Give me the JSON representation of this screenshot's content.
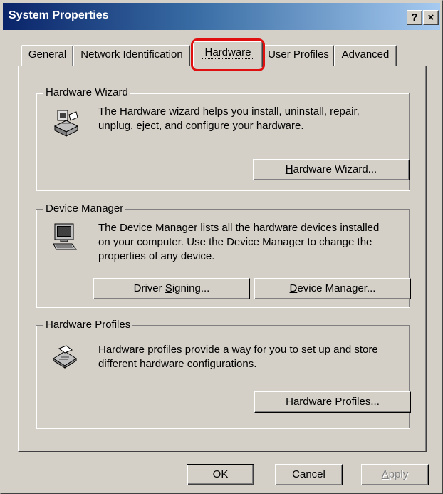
{
  "window": {
    "title": "System Properties",
    "help_button": "?",
    "close_button": "×"
  },
  "tabs": [
    {
      "label": "General"
    },
    {
      "label": "Network Identification"
    },
    {
      "label": "Hardware"
    },
    {
      "label": "User Profiles"
    },
    {
      "label": "Advanced"
    }
  ],
  "active_tab": "Hardware",
  "highlight_color": "#e01010",
  "groups": {
    "hardware_wizard": {
      "title": "Hardware Wizard",
      "text_line1": "The Hardware wizard helps you install, uninstall, repair,",
      "text_line2": "unplug, eject, and configure your hardware.",
      "button": {
        "pre": "",
        "accel": "H",
        "post": "ardware Wizard..."
      },
      "icon": "hardware-wizard-icon"
    },
    "device_manager": {
      "title": "Device Manager",
      "text_line1": "The Device Manager lists all the hardware devices installed",
      "text_line2": "on your computer. Use the Device Manager to change the",
      "text_line3": "properties of any device.",
      "driver_button": {
        "pre": "Driver ",
        "accel": "S",
        "post": "igning..."
      },
      "manager_button": {
        "pre": "",
        "accel": "D",
        "post": "evice Manager..."
      },
      "icon": "computer-icon"
    },
    "hardware_profiles": {
      "title": "Hardware Profiles",
      "text_line1": "Hardware profiles provide a way for you to set up and store",
      "text_line2": "different hardware configurations.",
      "button": {
        "pre": "Hardware ",
        "accel": "P",
        "post": "rofiles..."
      },
      "icon": "hardware-profiles-icon"
    }
  },
  "footer": {
    "ok": "OK",
    "cancel": "Cancel",
    "apply": {
      "pre": "",
      "accel": "A",
      "post": "pply"
    }
  }
}
